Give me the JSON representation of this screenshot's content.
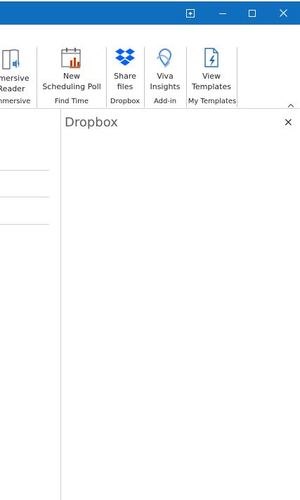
{
  "window": {
    "restore_icon": "ribbon-display-icon",
    "minimize_icon": "minimize-icon",
    "maximize_icon": "maximize-icon",
    "close_icon": "close-icon",
    "accent": "#106ebe"
  },
  "ribbon": {
    "immersive": {
      "line1": "nmersive",
      "line2": "Reader",
      "group": "nmersive"
    },
    "find_time": {
      "line1": "New",
      "line2": "Scheduling Poll",
      "group": "Find Time"
    },
    "dropbox": {
      "line1": "Share",
      "line2": "files",
      "group": "Dropbox"
    },
    "addin": {
      "line1": "Viva",
      "line2": "Insights",
      "group": "Add-in"
    },
    "templates": {
      "line1": "View",
      "line2": "Templates",
      "group": "My Templates"
    },
    "collapse": "^"
  },
  "pane": {
    "title": "Dropbox",
    "close": "×"
  }
}
